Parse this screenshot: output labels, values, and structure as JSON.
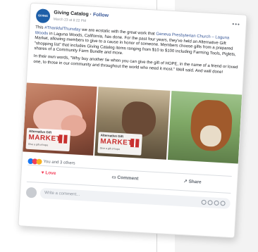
{
  "post": {
    "page_name": "Giving Catalog",
    "follow": "Follow",
    "separator": " · ",
    "date": "March 23 at 8:22 PM",
    "avatar_text": "GIVING CATALOG",
    "more": "•••",
    "paragraph1": {
      "prefix": "This ",
      "hashtag": "#ThankfulThursday",
      "mid": " we are ecstatic with the great work that ",
      "church": "Geneva Presbyterian Church – Laguna Woods",
      "rest": " in Laguna Woods, California, has done. For the past four years, they've held an Alternative Gift Market, allowing members to give to a cause in honor of someone. Members choose gifts from a prepared \"shopping list\" that includes Giving Catalog items ranging from $10 to $100 including Farming Tools, Piglets, shares of a Community Farm Bundle and more."
    },
    "paragraph2": "In their own words, \"Why buy another tie when you can give the gift of HOPE, in the name of a friend or loved one, to those in our community and throughout the world who need it most.\" Well said. And well done!",
    "photo_badge": {
      "top": "Alternative Gift",
      "big": "MARKET",
      "sub": "Give a gift of hope"
    },
    "reactions_text": "You and 3 others",
    "actions": {
      "love": "Love",
      "comment": "Comment",
      "share": "Share"
    },
    "comment_placeholder": "Write a comment..."
  },
  "colors": {
    "link": "#385898",
    "love": "#f33e58",
    "brand": "#1e5fa8"
  }
}
